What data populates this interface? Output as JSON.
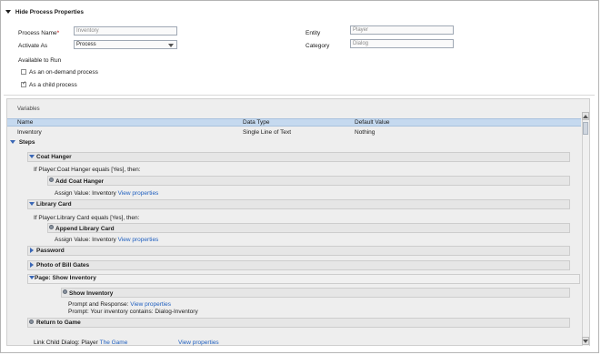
{
  "section": {
    "title": "Hide Process Properties"
  },
  "form": {
    "process_name_label": "Process Name",
    "process_name_value": "Inventory",
    "activate_as_label": "Activate As",
    "activate_as_value": "Process",
    "entity_label": "Entity",
    "entity_value": "Player",
    "category_label": "Category",
    "category_value": "Dialog",
    "available_label": "Available to Run",
    "on_demand_label": "As an on-demand process",
    "child_label": "As a child process"
  },
  "variables": {
    "title": "Variables",
    "columns": [
      "Name",
      "Data Type",
      "Default Value"
    ],
    "rows": [
      [
        "Inventory",
        "Single Line of Text",
        "Nothing"
      ]
    ]
  },
  "steps": {
    "title": "Steps",
    "coat_hanger": "Coat Hanger",
    "coat_condition": "If Player:Coat Hanger equals [Yes], then:",
    "add_coat": "Add Coat Hanger",
    "assign1": "Assign Value:  Inventory",
    "view_props": "View properties",
    "library_card": "Library Card",
    "library_condition": "If Player:Library Card equals [Yes], then:",
    "append_library": "Append Library Card",
    "assign2": "Assign Value:  Inventory",
    "password": "Password",
    "photo": "Photo of Bill Gates",
    "page_label": "Page:",
    "page_name": "Show Inventory",
    "show_inventory": "Show Inventory",
    "prompt_response": "Prompt and Response:",
    "prompt_text": "Prompt:  Your inventory contains: Dialog-Inventory",
    "return_game": "Return to Game",
    "link_child": "Link Child Dialog:  Player",
    "the_game": "The Game"
  },
  "colors": {
    "accent": "#3a67b5",
    "selected_row": "#c5d9ef",
    "link": "#1f5fbf",
    "required": "#cc0000"
  }
}
